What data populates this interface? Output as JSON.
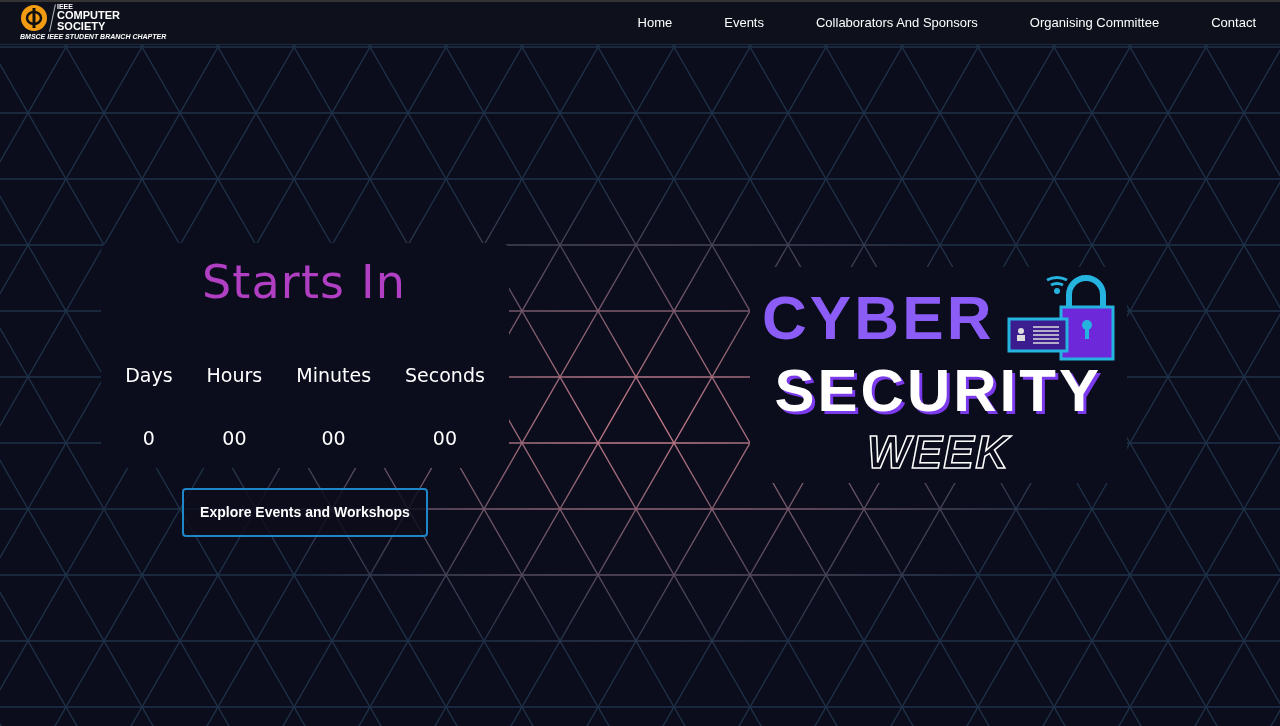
{
  "header": {
    "logo": {
      "top": "IEEE",
      "name_line1": "COMPUTER",
      "name_line2": "SOCIETY",
      "subtitle": "BMSCE IEEE STUDENT BRANCH CHAPTER"
    },
    "nav": [
      {
        "label": "Home"
      },
      {
        "label": "Events"
      },
      {
        "label": "Collaborators And Sponsors"
      },
      {
        "label": "Organising Committee"
      },
      {
        "label": "Contact"
      }
    ]
  },
  "countdown": {
    "heading": "Starts In",
    "units": [
      {
        "label": "Days",
        "value": "0"
      },
      {
        "label": "Hours",
        "value": "00"
      },
      {
        "label": "Minutes",
        "value": "00"
      },
      {
        "label": "Seconds",
        "value": "00"
      }
    ],
    "button": "Explore Events and Workshops"
  },
  "title": {
    "line1": "CYBER",
    "line2": "SECURITY",
    "line3": "WEEK"
  }
}
